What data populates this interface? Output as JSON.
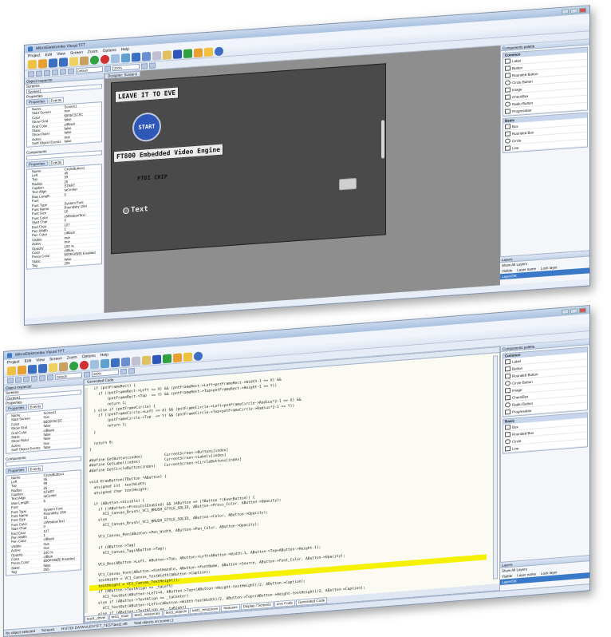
{
  "app": {
    "title": "MikroElektronika Visual TFT",
    "menu": [
      "Project",
      "Edit",
      "View",
      "Screen",
      "Zoom",
      "Options",
      "Help"
    ],
    "zoom_value": "200%",
    "default_select": "Default"
  },
  "object_inspector": {
    "header": "Object Inspector",
    "screens_label": "Screens",
    "screen_value": "Screen1",
    "properties_label": "Properties",
    "tabs": [
      "Properties",
      "Events"
    ],
    "screen_props": [
      {
        "k": "Name",
        "v": "Screen1"
      },
      {
        "k": "Start Screen",
        "v": "true"
      },
      {
        "k": "Color",
        "v": "$505C5C5C"
      },
      {
        "k": "Show Grid",
        "v": "false"
      },
      {
        "k": "Grid Color",
        "v": "clBlack"
      },
      {
        "k": "Static",
        "v": "false"
      },
      {
        "k": "Show Ruler",
        "v": "false"
      },
      {
        "k": "Active",
        "v": "true"
      },
      {
        "k": "Sniff Object Events",
        "v": "false"
      }
    ],
    "components_label": "Components",
    "component_props": [
      {
        "k": "Name",
        "v": "CircleButton1"
      },
      {
        "k": "Left",
        "v": "45"
      },
      {
        "k": "Top",
        "v": "99"
      },
      {
        "k": "Radius",
        "v": "25"
      },
      {
        "k": "Caption",
        "v": "START"
      },
      {
        "k": "Text Align",
        "v": "taCenter"
      },
      {
        "k": "Max Length",
        "v": "5"
      },
      {
        "k": "Font",
        "v": ""
      },
      {
        "k": "Font Type",
        "v": "System Font"
      },
      {
        "k": "Font Name",
        "v": "Roundsky 18H"
      },
      {
        "k": "Font Size",
        "v": "10"
      },
      {
        "k": "Font Color",
        "v": "clWindowText"
      },
      {
        "k": "Start Char",
        "v": "0"
      },
      {
        "k": "End Char",
        "v": "127"
      },
      {
        "k": "Pen Width",
        "v": "1"
      },
      {
        "k": "Pen Color",
        "v": "clBlack"
      },
      {
        "k": "Visible",
        "v": "true"
      },
      {
        "k": "Active",
        "v": "true"
      },
      {
        "k": "Opacity",
        "v": "100 %"
      },
      {
        "k": "Color",
        "v": "clBlue"
      },
      {
        "k": "Press Color",
        "v": "$00RGB(B)   Enabled"
      },
      {
        "k": "Static",
        "v": "false"
      },
      {
        "k": "Tag",
        "v": "255"
      }
    ]
  },
  "designer": {
    "doc_tab": "Designer: Screen1",
    "label_top": "LEAVE IT TO EVE",
    "start_caption": "START",
    "label_engine": "FT800 Embedded Video Engine",
    "label_chip": "FTDI CHIP",
    "radio_caption": "Text"
  },
  "palette": {
    "header": "Components palette",
    "groups": [
      {
        "name": "Common",
        "items": [
          "Label",
          "Button",
          "Rounded Button",
          "Circle Button",
          "Image",
          "CheckBox",
          "Radio Button",
          "Progressbar"
        ]
      },
      {
        "name": "Basic",
        "items": [
          "Box",
          "Rounded Box",
          "Circle",
          "Line"
        ]
      }
    ]
  },
  "layers": {
    "header": "Layers",
    "show_all": "Show All Layers",
    "cols": [
      "Visible",
      "Layer name",
      "Lock layer"
    ],
    "row_name": "Layer/OK"
  },
  "status": {
    "left": "No object selected",
    "screen": "Screen1",
    "path": "H:\\FTDI DATA\\VLE\\VTFT_TEST\\test1.vtft",
    "objects": "Total objects on screen:1"
  },
  "code": {
    "header": "Generated Code",
    "lines": [
      "  if (pntFrameRect) {",
      "    if ((pntFrameRect->Left <= X) && (pntFrameRect->Left+pntFrameRect->Width-1 >= X) &&",
      "        (pntFrameRect->Top  <= Y) && (pntFrameRect->Top+pntFrameRect->Height-1 >= Y))",
      "        return 1;",
      "  } else if (pntFrameCircle) {",
      "    if ((pntFrameCircle->Left <= X) && (pntFrameCircle->Left+pntFrameCircle->Radius*2-1 >= X) &&",
      "        (pntFrameCircle->Top  <= Y) && (pntFrameCircle->Top+pntFrameCircle->Radius*2-1 >= Y))",
      "        return 1;",
      "  }",
      "",
      "  return 0;",
      "}",
      "",
      "#define GetButton(index)          CurrentScreen->Buttons[index]",
      "#define GetLabel(index)           CurrentScreen->Labels[index]",
      "#define GetCircleButton(index)    CurrentScreen->CircleButtons[index]",
      "",
      "void DrawButton(TButton *AButton) {",
      "  unsigned int  textWidth;",
      "  unsigned char textHeight;",
      "",
      "  if (AButton->Visible) {",
      "    if ((AButton->PressColEnabled) && (AButton == (TButton *)ExecButton)) {",
      "      VC1_Canvas_Brush(_VC1_BRUSH_STYLE_SOLID, AButton->Press_Color, AButton->Opacity);",
      "    else",
      "      VC1_Canvas_Brush(_VC1_BRUSH_STYLE_SOLID, AButton->Color, AButton->Opacity);",
      "",
      "    VC1_Canvas_Pen(AButton->Pen_Width, AButton->Pen_Color, AButton->Opacity);",
      "",
      "    if (AButton->Tag)",
      "      VC1_Canvas_Tag(AButton->Tag);",
      "",
      "    VC1_Box(AButton->Left, AButton->Top, AButton->Left+AButton->Width-1, AButton->Top+AButton->Height-1);",
      "",
      "    VC1_Canvas_Font(AButton->FontHandle, AButton->FontName, AButton->Source, AButton->Font_Color, AButton->Opacity);",
      "    textWidth = VC1_Canvas_TextWidth(AButton->Caption);",
      "    textHeight = VC1_Canvas_TextHeight();",
      "    if (AButton->TextAlign == _taLeft)",
      "      VC1_TextOut(AButton->Left+4, AButton->Top+(AButton->Height-textHeight)/2, AButton->Caption);",
      "    else if (AButton->TextAlign == _taCenter)",
      "      VC1_TextOut(AButton->Left+(AButton->Width-textWidth)/2, AButton->Top+(AButton->Height-textHeight)/2, AButton->Caption);",
      "    else if (AButton->TextAlign == _taRight)"
    ],
    "highlight_line": 36,
    "tabs": [
      "test1_driver",
      "test1_main",
      "test1_resources",
      "test1_objects",
      "test1_resources"
    ],
    "bottom_tabs": [
      "Statuses",
      "Display / Screens",
      "Live Code",
      "Generated Code"
    ]
  },
  "colors": {
    "start_button": "#2f57b8",
    "screen_bg": "#4a4a4a",
    "highlight": "#f5f100"
  }
}
